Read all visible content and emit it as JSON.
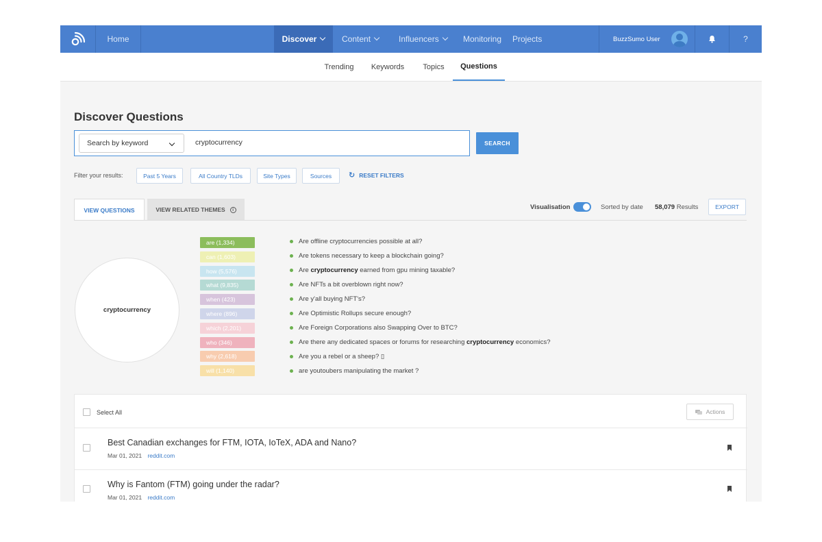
{
  "nav": {
    "home": "Home",
    "discover": "Discover",
    "content": "Content",
    "influencers": "Influencers",
    "monitoring": "Monitoring",
    "projects": "Projects",
    "user": "BuzzSumo User",
    "help": "?",
    "icons": [
      "buzzsumo-logo-icon",
      "chevron-down-icon",
      "avatar",
      "bell-icon"
    ]
  },
  "subnav": {
    "tabs": [
      "Trending",
      "Keywords",
      "Topics",
      "Questions"
    ],
    "active": "Questions"
  },
  "page": {
    "title": "Discover Questions",
    "search_type": "Search by keyword",
    "query": "cryptocurrency",
    "search_button": "SEARCH"
  },
  "filters": {
    "label": "Filter your results:",
    "chips": [
      "Past 5 Years",
      "All Country TLDs",
      "Site Types",
      "Sources"
    ],
    "reset": "RESET FILTERS"
  },
  "view": {
    "tab_questions": "VIEW QUESTIONS",
    "tab_themes": "VIEW RELATED THEMES",
    "info_icon": "i",
    "visualisation_label": "Visualisation",
    "visualisation_on": true,
    "sorted": "Sorted by date",
    "results_count": "58,079",
    "results_label": "Results",
    "export": "EXPORT"
  },
  "visualisation": {
    "center": "cryptocurrency",
    "words": [
      {
        "label": "are (1,334)",
        "color": "#8cbd5c"
      },
      {
        "label": "can (1,603)",
        "color": "#eef0b4"
      },
      {
        "label": "how (5,576)",
        "color": "#c8e5f0"
      },
      {
        "label": "what (9,835)",
        "color": "#b5dad4"
      },
      {
        "label": "when (423)",
        "color": "#d7c4dc"
      },
      {
        "label": "where (896)",
        "color": "#cfd5ea"
      },
      {
        "label": "which (2,201)",
        "color": "#f6d2d8"
      },
      {
        "label": "who (346)",
        "color": "#efb2bd"
      },
      {
        "label": "why (2,618)",
        "color": "#f8ccaf"
      },
      {
        "label": "will (1,140)",
        "color": "#f8e0a8"
      }
    ],
    "questions": [
      {
        "pre": "Are offline cryptocurrencies possible at all?",
        "bold": "",
        "post": ""
      },
      {
        "pre": "Are tokens necessary to keep a blockchain going?",
        "bold": "",
        "post": ""
      },
      {
        "pre": "Are ",
        "bold": "cryptocurrency",
        "post": " earned from gpu mining taxable?"
      },
      {
        "pre": "Are NFTs a bit overblown right now?",
        "bold": "",
        "post": ""
      },
      {
        "pre": "Are y'all buying NFT's?",
        "bold": "",
        "post": ""
      },
      {
        "pre": "Are Optimistic Rollups secure enough?",
        "bold": "",
        "post": ""
      },
      {
        "pre": "Are Foreign Corporations also Swapping Over to BTC?",
        "bold": "",
        "post": ""
      },
      {
        "pre": "Are there any dedicated spaces or forums for researching ",
        "bold": "cryptocurrency",
        "post": " economics?"
      },
      {
        "pre": "Are you a rebel or a sheep? ▯",
        "bold": "",
        "post": ""
      },
      {
        "pre": "are youtoubers manipulating the market ?",
        "bold": "",
        "post": ""
      }
    ]
  },
  "list": {
    "select_all": "Select All",
    "actions": "Actions",
    "rows": [
      {
        "title": "Best Canadian exchanges for FTM, IOTA, IoTeX, ADA and Nano?",
        "date": "Mar 01, 2021",
        "source": "reddit.com"
      },
      {
        "title": "Why is Fantom (FTM) going under the radar?",
        "date": "Mar 01, 2021",
        "source": "reddit.com"
      }
    ]
  }
}
